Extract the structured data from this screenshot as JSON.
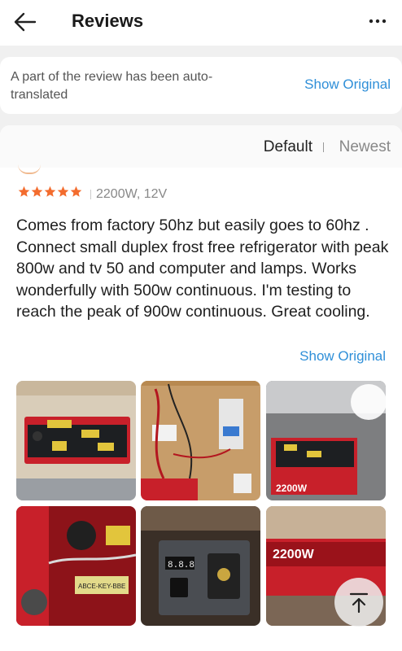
{
  "header": {
    "title": "Reviews"
  },
  "notice": {
    "text": "A part of the review has been auto-translated",
    "link": "Show Original"
  },
  "sort": {
    "default_label": "Default",
    "newest_label": "Newest",
    "selected": "Default"
  },
  "review": {
    "rating": 5,
    "rating_max": 5,
    "variant": "2200W, 12V",
    "text": "Comes from factory 50hz but easily goes to 60hz . Connect small duplex frost free refrigerator with peak 800w and tv 50 and computer and lamps. Works wonderfully with 500w continuous. I'm testing to reach the peak of 900w continuous. Great cooling.",
    "show_original": "Show Original",
    "photos": [
      {
        "name": "review-photo-1",
        "overlay_text": ""
      },
      {
        "name": "review-photo-2",
        "overlay_text": ""
      },
      {
        "name": "review-photo-3",
        "overlay_text": "2200W"
      },
      {
        "name": "review-photo-4",
        "overlay_text": "ABCE-KEY-BBE"
      },
      {
        "name": "review-photo-5",
        "overlay_text": "8.8.8"
      },
      {
        "name": "review-photo-6",
        "overlay_text": "2200W"
      }
    ]
  },
  "colors": {
    "accent_link": "#2f8fd8",
    "star": "#f36c2e",
    "inverter_red": "#c8202a"
  },
  "icons": [
    "back-arrow-icon",
    "more-dots-icon",
    "star-icon",
    "scroll-to-top-icon"
  ]
}
